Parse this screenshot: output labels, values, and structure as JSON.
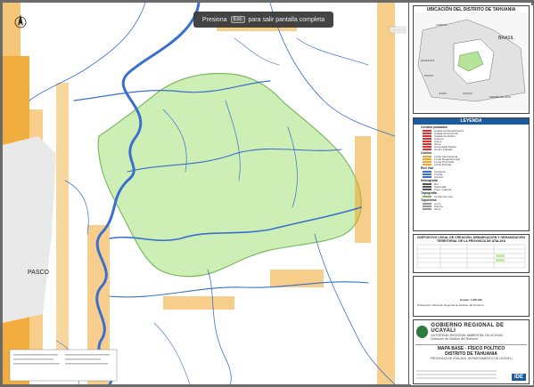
{
  "overlay": {
    "prefix": "Presiona",
    "key": "Esc",
    "suffix": "para salir pantalla completa"
  },
  "map": {
    "labels": {
      "pasco": "PASCO",
      "brasil_top": "BRASIL"
    },
    "colors": {
      "district_fill": "#cdeeb4",
      "district_border": "#7dba64",
      "relief": "#f0a52a",
      "rivers": "#3a6fd0",
      "background": "#ffffff"
    }
  },
  "location_box": {
    "title": "UBICACIÓN DEL DISTRITO DE TAHUANIA",
    "labels": {
      "brasil": "BRASIL",
      "loreto": "LORETO",
      "huanuco": "HUANUCO",
      "pasco": "PASCO",
      "junin": "JUNIN",
      "cusco": "CUSCO",
      "madre_de_dios": "MADRE DE DIOS"
    }
  },
  "legend": {
    "title": "LEYENDA",
    "groups": [
      {
        "name": "Centros poblados",
        "items": [
          "Capital de Departamento",
          "Capital de Provincia",
          "Capital de Distrito",
          "Caserío",
          "Anexo",
          "Otros",
          "Comunidad Nativa",
          "Centro Poblado"
        ]
      },
      {
        "name": "Límites",
        "items": [
          "Límite Internacional",
          "Límite Departamental",
          "Límite Provincial",
          "Límite Distrital"
        ]
      },
      {
        "name": "Red Vial",
        "items": [
          "Carretera",
          "Trocha",
          "Camino"
        ]
      },
      {
        "name": "Hidrografía",
        "items": [
          "Río",
          "Quebrada",
          "Lago / Laguna"
        ]
      },
      {
        "name": "Topografía",
        "items": [
          "Curvas de nivel"
        ]
      },
      {
        "name": "Toponimia",
        "items": [
          "Cerro",
          "Pampa",
          "Otros"
        ]
      }
    ]
  },
  "dispositivo": {
    "title": "DISPOSITIVO LEGAL DE CREACIÓN, DEMARCACIÓN Y ORGANIZACIÓN TERRITORIAL DE LA PROVINCIA DE ATALAYA"
  },
  "scale": {
    "text": "Escala: 1:300,000"
  },
  "credits": {
    "text": "Producción: Dirección Regional de Gestión del Territorio"
  },
  "title_block": {
    "gobierno": "GOBIERNO REGIONAL DE UCAYALI",
    "autoridad": "AUTORIDAD REGIONAL AMBIENTAL DE UCAYALI",
    "direccion": "Dirección de Gestión del Territorio",
    "mapa": "MAPA BASE - FÍSICO POLÍTICO",
    "distrito": "DISTRITO DE TAHUANIA",
    "provincia": "PROVINCIA DE ATALAYA, DEPARTAMENTO DE UCAYALI",
    "logo_right": "IDE"
  }
}
